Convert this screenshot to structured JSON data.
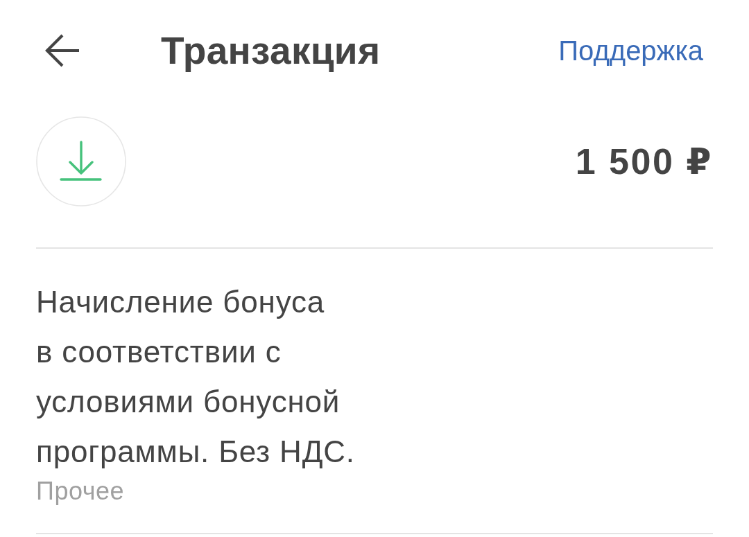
{
  "header": {
    "title": "Транзакция",
    "support_link": "Поддержка"
  },
  "transaction": {
    "amount": "1 500 ₽",
    "description": "Начисление бонуса в соответствии с условиями бонусной программы. Без НДС.",
    "category": "Прочее"
  }
}
